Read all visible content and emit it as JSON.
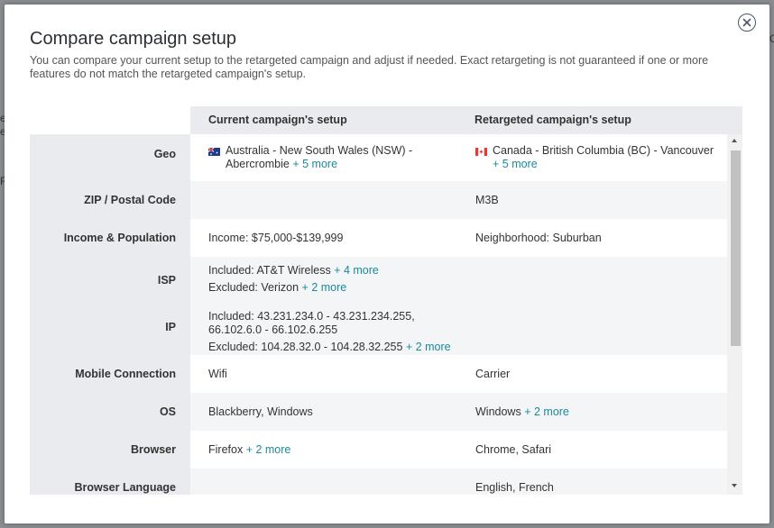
{
  "background": {
    "fragments": [
      "e",
      "e",
      "R",
      "G"
    ]
  },
  "modal": {
    "title": "Compare campaign setup",
    "subtitle": "You can compare your current setup to the retargeted campaign and adjust if needed. Exact retargeting is not guaranteed if one or more features do not match the retargeted campaign's setup.",
    "close_icon": "close-circle-icon",
    "headers": {
      "current": "Current campaign's setup",
      "retargeted": "Retargeted campaign's setup"
    },
    "rows": [
      {
        "label": "Geo",
        "current": {
          "flag": "australia-flag-icon",
          "line1": "Australia - New South Wales (NSW) -",
          "line2": "Abercrombie",
          "more": "+ 5 more"
        },
        "retargeted": {
          "flag": "canada-flag-icon",
          "line1": "Canada - British Columbia (BC) -  Vancouver",
          "more": "+ 5 more"
        }
      },
      {
        "label": "ZIP / Postal Code",
        "current": "",
        "retargeted": "M3B"
      },
      {
        "label": "Income & Population",
        "current": "Income: $75,000-$139,999",
        "retargeted": "Neighborhood: Suburban"
      },
      {
        "label": "ISP",
        "current": {
          "included": "Included: AT&T Wireless",
          "included_more": "+ 4 more",
          "excluded": "Excluded: Verizon",
          "excluded_more": "+ 2 more"
        },
        "retargeted": ""
      },
      {
        "label": "IP",
        "current": {
          "included1": "Included:  43.231.234.0 - 43.231.234.255,",
          "included2": "66.102.6.0 - 66.102.6.255",
          "excluded": "Excluded: 104.28.32.0 - 104.28.32.255",
          "excluded_more": "+ 2 more"
        },
        "retargeted": ""
      },
      {
        "label": "Mobile Connection",
        "current": "Wifi",
        "retargeted": "Carrier"
      },
      {
        "label": "OS",
        "current": "Blackberry, Windows",
        "retargeted": "Windows",
        "retargeted_more": "+ 2 more"
      },
      {
        "label": "Browser",
        "current": "Firefox",
        "current_more": "+ 2 more",
        "retargeted": "Chrome, Safari"
      },
      {
        "label": "Browser Language",
        "current": "",
        "retargeted": "English, French"
      }
    ]
  },
  "colors": {
    "accent": "#1a8a9a",
    "header_bg": "#e9ebee",
    "alt_row_bg": "#f3f5f7",
    "overlay": "#8a8d91"
  }
}
